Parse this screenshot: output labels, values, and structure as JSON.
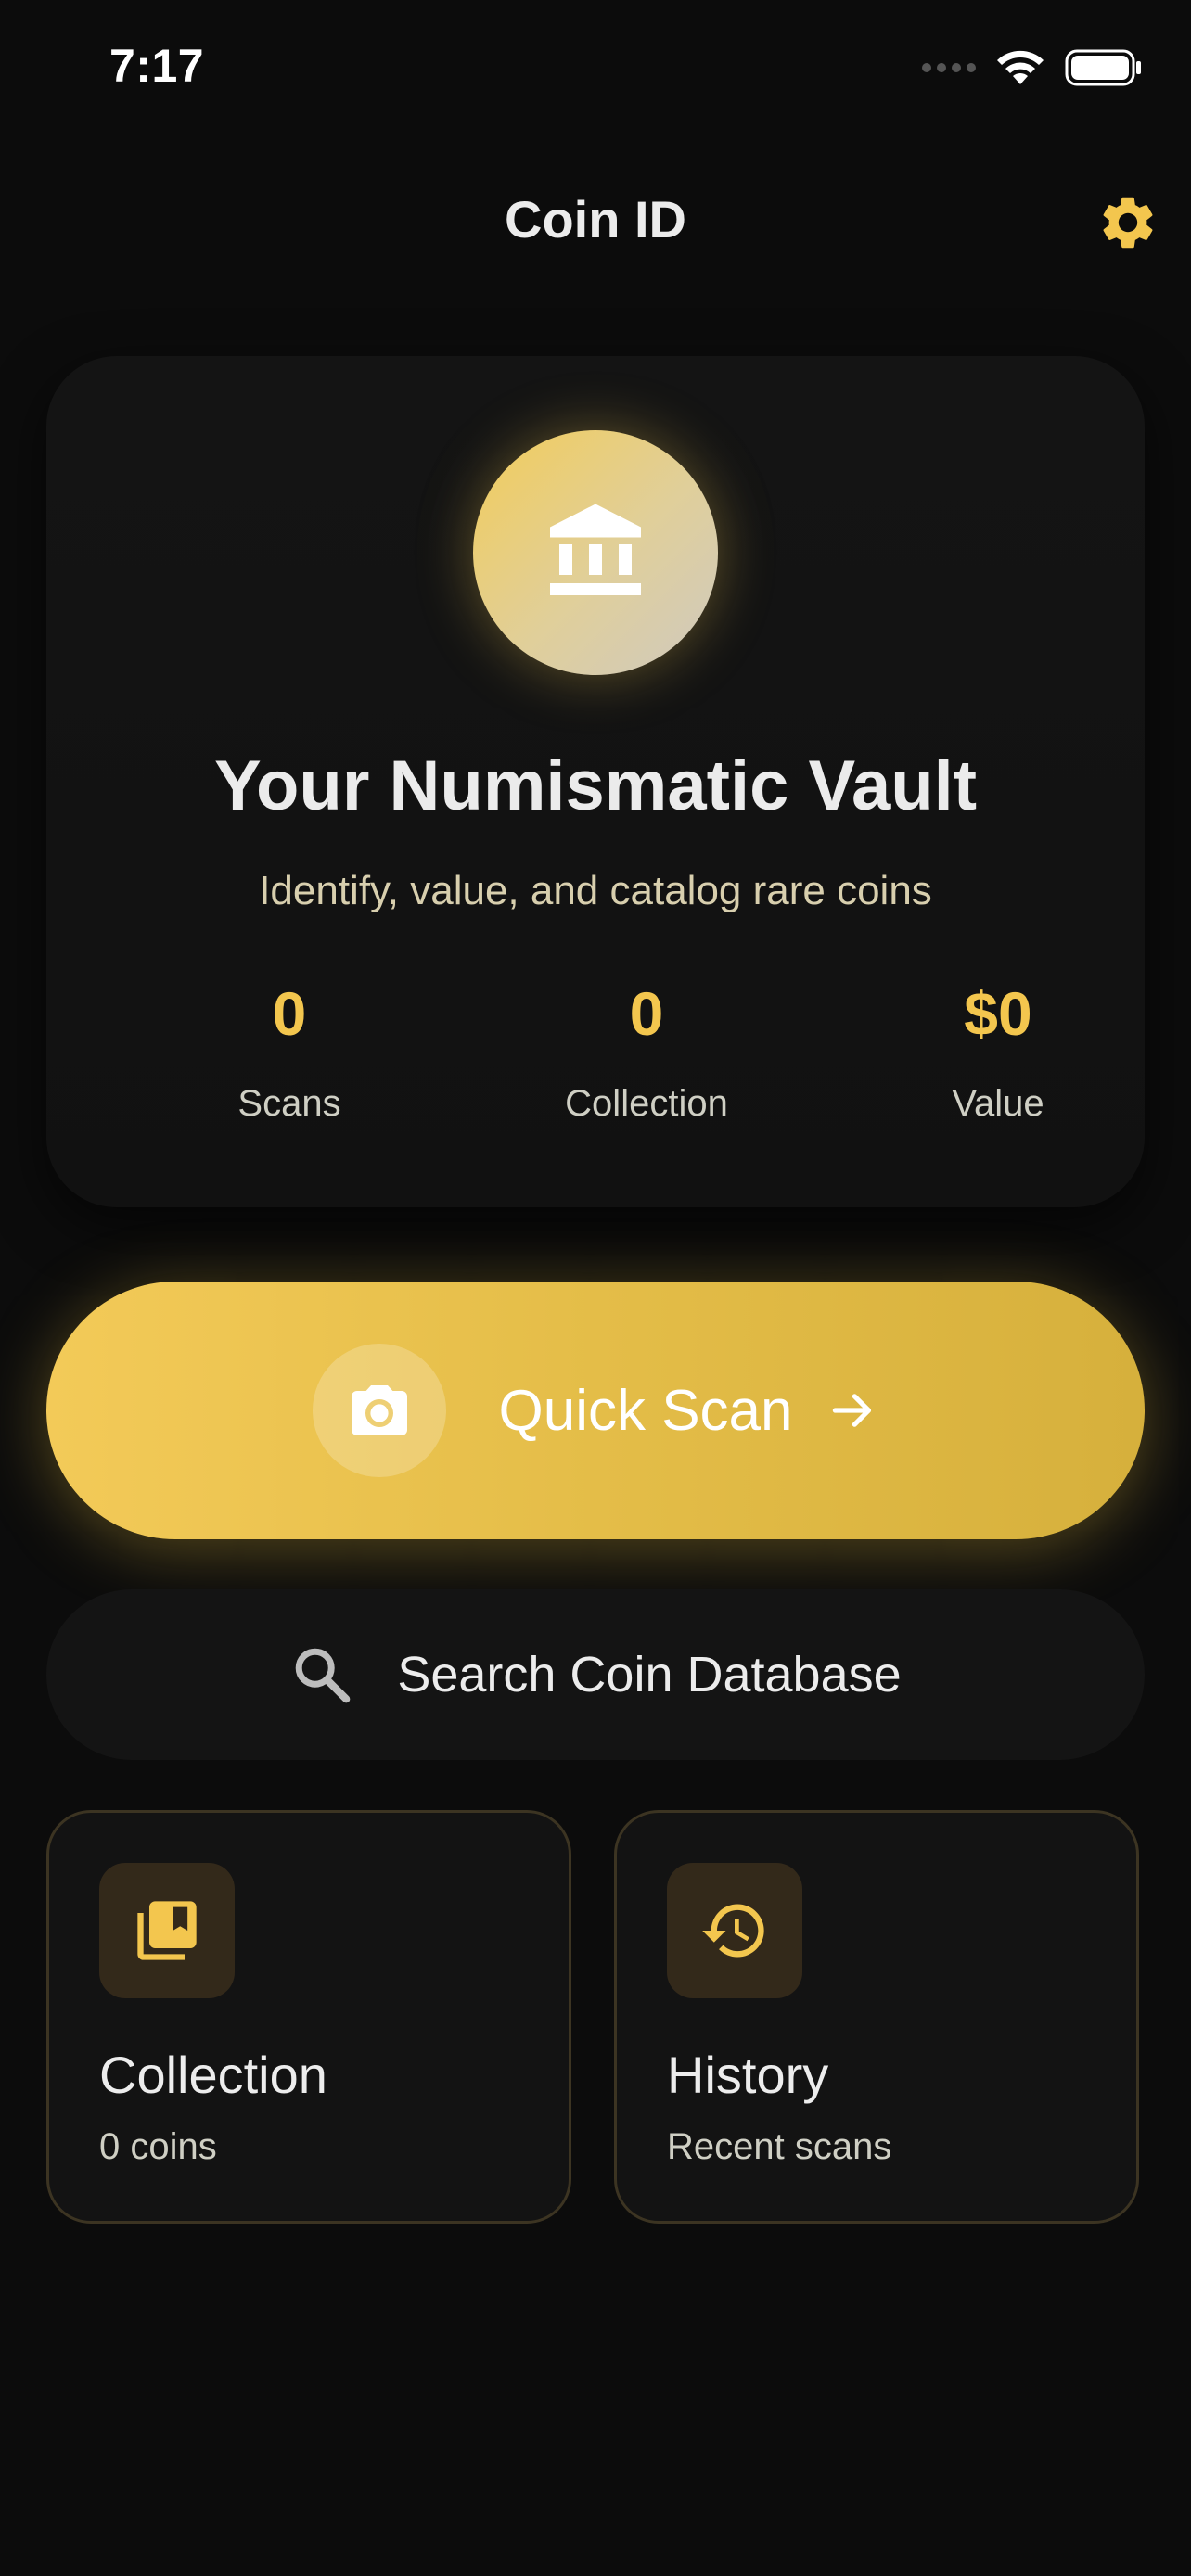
{
  "status_bar": {
    "time": "7:17"
  },
  "header": {
    "title": "Coin ID",
    "settings_icon": "gear-icon"
  },
  "vault": {
    "emblem_icon": "bank-icon",
    "title": "Your Numismatic Vault",
    "subtitle": "Identify, value, and catalog rare coins",
    "stats": [
      {
        "value": "0",
        "label": "Scans"
      },
      {
        "value": "0",
        "label": "Collection"
      },
      {
        "value": "$0",
        "label": "Value"
      }
    ]
  },
  "quick_scan": {
    "label": "Quick Scan",
    "icon": "camera-icon",
    "trailing_icon": "arrow-right-icon"
  },
  "search": {
    "label": "Search Coin Database",
    "icon": "search-icon"
  },
  "tiles": [
    {
      "title": "Collection",
      "subtitle": "0 coins",
      "icon": "collection-icon"
    },
    {
      "title": "History",
      "subtitle": "Recent scans",
      "icon": "history-icon"
    }
  ],
  "colors": {
    "accent": "#f3c64e",
    "background": "#0c0c0c",
    "card": "#131313"
  }
}
